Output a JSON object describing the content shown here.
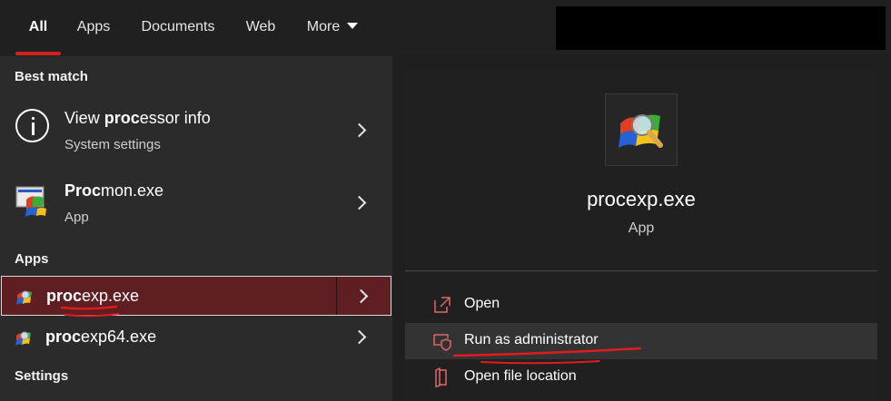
{
  "tabs": [
    {
      "label": "All"
    },
    {
      "label": "Apps"
    },
    {
      "label": "Documents"
    },
    {
      "label": "Web"
    },
    {
      "label": "More"
    }
  ],
  "left": {
    "best_match_heading": "Best match",
    "apps_heading": "Apps",
    "settings_heading": "Settings",
    "results": [
      {
        "bold": "View proc",
        "rest_pre": "View ",
        "match": "proc",
        "rest": "essor info",
        "subtitle": "System settings"
      },
      {
        "match": "Proc",
        "rest": "mon.exe",
        "subtitle": "App"
      },
      {
        "match": "proc",
        "rest": "exp.exe"
      },
      {
        "match": "proc",
        "rest": "exp64.exe"
      }
    ]
  },
  "preview": {
    "name": "procexp.exe",
    "type": "App",
    "actions": [
      {
        "label": "Open"
      },
      {
        "label": "Run as administrator"
      },
      {
        "label": "Open file location"
      }
    ]
  },
  "colors": {
    "accent": "#d21f1f",
    "selected_bg": "#5e1e22",
    "annotation": "#e01c1c"
  }
}
